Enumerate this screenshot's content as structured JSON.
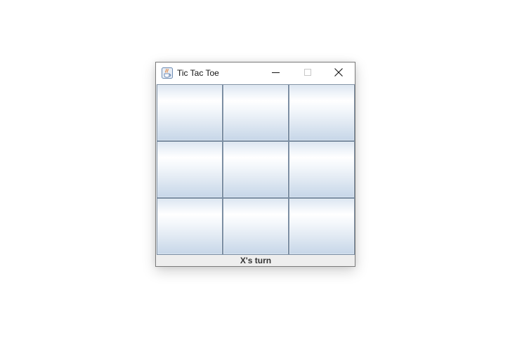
{
  "window": {
    "title": "Tic Tac Toe",
    "app_icon": "java-cup-icon",
    "controls": {
      "minimize_icon": "minimize-icon",
      "maximize_icon": "maximize-icon",
      "close_icon": "close-icon"
    }
  },
  "board": {
    "cells": [
      "",
      "",
      "",
      "",
      "",
      "",
      "",
      "",
      ""
    ]
  },
  "status": {
    "text": "X's turn"
  },
  "colors": {
    "cell_border": "#7b8ea3",
    "cell_gradient_top": "#dce6f1",
    "cell_gradient_bottom": "#c6d6e8",
    "window_bg": "#eeeeee",
    "titlebar_bg": "#ffffff",
    "status_text": "#333333"
  }
}
